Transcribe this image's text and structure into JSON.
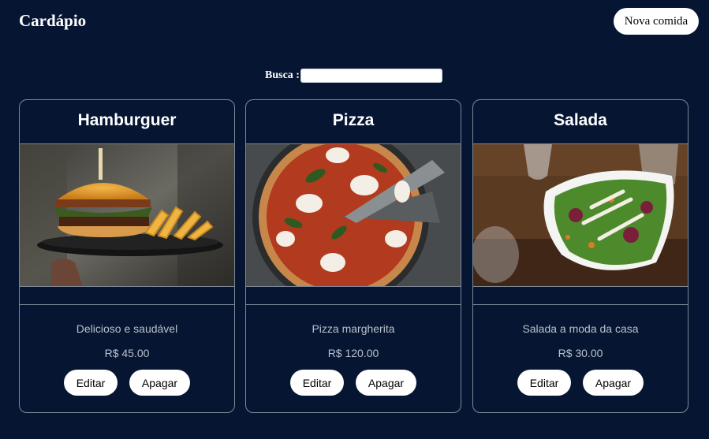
{
  "header": {
    "title": "Cardápio",
    "new_button_label": "Nova comida"
  },
  "search": {
    "label": "Busca :",
    "value": ""
  },
  "cards": [
    {
      "title": "Hamburguer",
      "image_icon": "burger-photo",
      "description": "Delicioso e saudável",
      "price": "R$ 45.00",
      "edit_label": "Editar",
      "delete_label": "Apagar"
    },
    {
      "title": "Pizza",
      "image_icon": "pizza-photo",
      "description": "Pizza margherita",
      "price": "R$ 120.00",
      "edit_label": "Editar",
      "delete_label": "Apagar"
    },
    {
      "title": "Salada",
      "image_icon": "salad-photo",
      "description": "Salada a moda da casa",
      "price": "R$ 30.00",
      "edit_label": "Editar",
      "delete_label": "Apagar"
    }
  ],
  "colors": {
    "background": "#061632",
    "card_border": "#7d8796",
    "text_muted": "#b9c0cb",
    "button_bg": "#ffffff"
  }
}
